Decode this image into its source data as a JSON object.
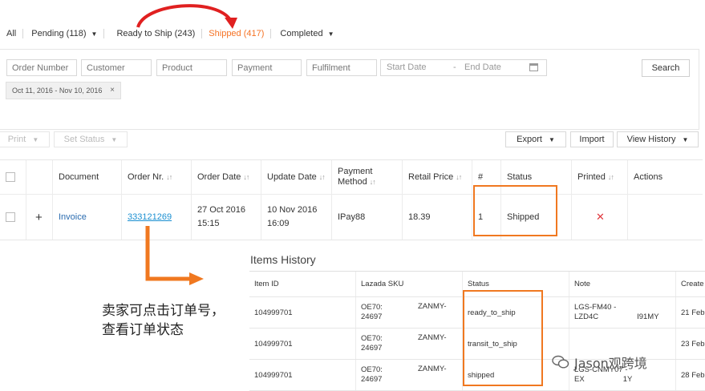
{
  "tabs": {
    "all": "All",
    "pending": "Pending (118)",
    "ready_to_ship": "Ready to Ship (243)",
    "shipped": "Shipped (417)",
    "completed": "Completed"
  },
  "filters": {
    "order_number": "Order Number",
    "customer": "Customer",
    "product": "Product",
    "payment": "Payment",
    "fulfilment": "Fulfilment",
    "start_date": "Start Date",
    "end_date": "End Date",
    "date_dash": "-",
    "search_label": "Search",
    "active_chip": "Oct 11, 2016 - Nov 10, 2016",
    "chip_close": "×"
  },
  "toolbar": {
    "print": "Print",
    "set_status": "Set Status",
    "export": "Export",
    "import": "Import",
    "view_history": "View History"
  },
  "orders_table": {
    "headers": {
      "document": "Document",
      "order_nr": "Order Nr.",
      "order_date": "Order Date",
      "update_date": "Update Date",
      "payment_method_1": "Payment",
      "payment_method_2": "Method",
      "retail_price": "Retail Price",
      "count": "#",
      "status": "Status",
      "printed": "Printed",
      "actions": "Actions"
    },
    "row": {
      "expand": "+",
      "document": "Invoice",
      "order_nr": "333121269",
      "order_date_1": "27 Oct 2016",
      "order_date_2": "15:15",
      "update_date_1": "10 Nov 2016",
      "update_date_2": "16:09",
      "payment_method": "IPay88",
      "retail_price": "18.39",
      "count": "1",
      "status": "Shipped",
      "printed": "✕"
    }
  },
  "items_history": {
    "title": "Items History",
    "headers": {
      "item_id": "Item ID",
      "lazada_sku": "Lazada SKU",
      "status": "Status",
      "note": "Note",
      "created": "Create"
    },
    "rows": [
      {
        "item_id": "104999701",
        "sku_1": "OE70:",
        "sku_2": "24697",
        "sku_extra": "ZANMY-",
        "status": "ready_to_ship",
        "note_1": "LGS-FM40 -",
        "note_2": "LZD4C",
        "note_extra": "I91MY",
        "created": "21 Feb"
      },
      {
        "item_id": "104999701",
        "sku_1": "OE70:",
        "sku_2": "24697",
        "sku_extra": "ZANMY-",
        "status": "transit_to_ship",
        "note_1": "",
        "note_2": "",
        "note_extra": "",
        "created": "23 Feb"
      },
      {
        "item_id": "104999701",
        "sku_1": "OE70:",
        "sku_2": "24697",
        "sku_extra": "ZANMY-",
        "status": "shipped",
        "note_1": "LGS-CNMY07 -",
        "note_2": "EX",
        "note_extra": "1Y",
        "created": "28 Feb"
      }
    ]
  },
  "annotation": {
    "caption_line1": "卖家可点击订单号，",
    "caption_line2": "查看订单状态",
    "accent_color": "#f07820",
    "arrow_color": "#e02020"
  },
  "watermark": {
    "text": "Jason观跨境"
  }
}
